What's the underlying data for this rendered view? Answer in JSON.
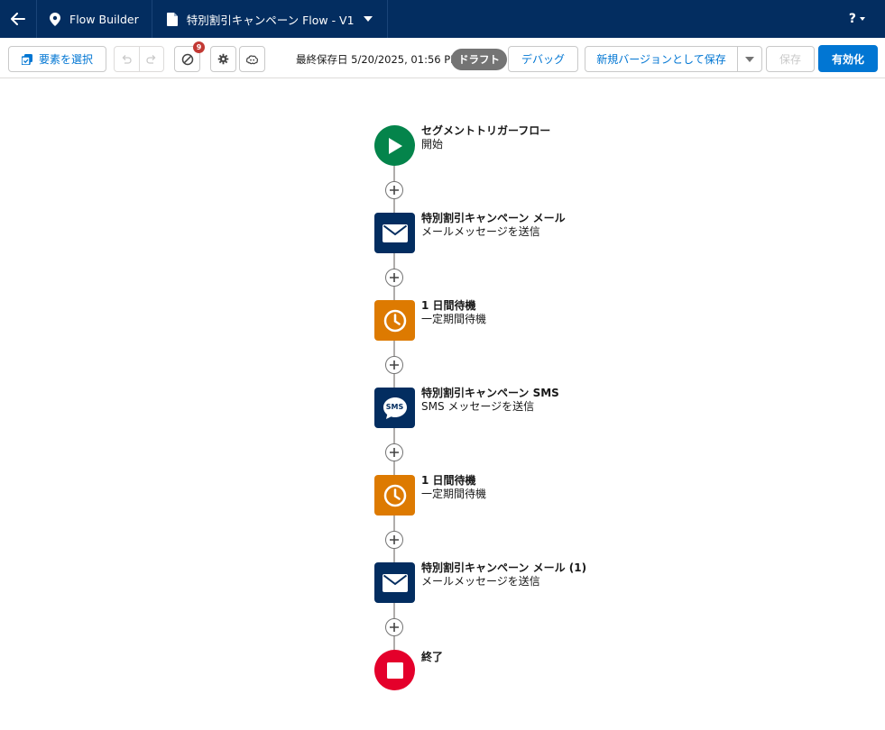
{
  "header": {
    "app_name": "Flow Builder",
    "flow_title": "特別割引キャンペーン Flow - V1",
    "help_label": "?"
  },
  "toolbar": {
    "select_elements_label": "要素を選択",
    "error_count": "9",
    "last_saved": "最終保存日 5/20/2025, 01:56 PM",
    "status_badge": "ドラフト",
    "debug_label": "デバッグ",
    "save_as_new_version_label": "新規バージョンとして保存",
    "save_label": "保存",
    "activate_label": "有効化"
  },
  "flow": {
    "nodes": [
      {
        "title": "セグメントトリガーフロー",
        "subtitle": "開始",
        "icon": "play-icon",
        "color": "#04844b"
      },
      {
        "title": "特別割引キャンペーン メール",
        "subtitle": "メールメッセージを送信",
        "icon": "email-icon",
        "color": "#032d60"
      },
      {
        "title": "1 日間待機",
        "subtitle": "一定期間待機",
        "icon": "clock-icon",
        "color": "#dd7a01"
      },
      {
        "title": "特別割引キャンペーン SMS",
        "subtitle": "SMS メッセージを送信",
        "icon": "sms-icon",
        "color": "#032d60",
        "icon_text": "SMS"
      },
      {
        "title": "1 日間待機",
        "subtitle": "一定期間待機",
        "icon": "clock-icon",
        "color": "#dd7a01"
      },
      {
        "title": "特別割引キャンペーン メール (1)",
        "subtitle": "メールメッセージを送信",
        "icon": "email-icon",
        "color": "#032d60"
      },
      {
        "title": "終了",
        "subtitle": "",
        "icon": "stop-icon",
        "color": "#e4002b"
      }
    ]
  },
  "colors": {
    "header_bg": "#032d60",
    "brand_blue": "#0176d3",
    "start_green": "#04844b",
    "wait_orange": "#dd7a01",
    "end_red": "#e4002b"
  }
}
